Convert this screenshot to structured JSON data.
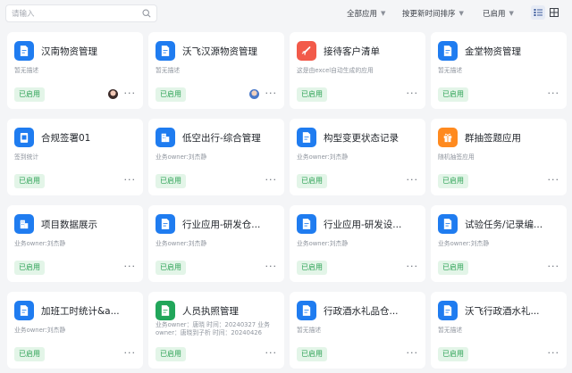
{
  "search": {
    "placeholder": "请输入"
  },
  "filters": {
    "status_filter": "全部应用",
    "sort": "按更新时间排序",
    "enabled_filter": "已启用"
  },
  "colors": {
    "icon_blue": "#1f7cf0",
    "icon_green": "#21a65a",
    "icon_red": "#f25a4a",
    "icon_orange": "#ff8a1f",
    "status_green": "#2ea256"
  },
  "apps": [
    {
      "name": "汉南物资管理",
      "desc": "暂无描述",
      "status": "已启用",
      "icon": "document-icon"
    },
    {
      "name": "沃飞汉源物资管理",
      "desc": "暂无描述",
      "status": "已启用",
      "icon": "document-icon"
    },
    {
      "name": "接待客户清单",
      "desc": "这是由excel自动生成的应用",
      "status": "已启用",
      "icon": "plane-icon"
    },
    {
      "name": "金堂物资管理",
      "desc": "暂无描述",
      "status": "已启用",
      "icon": "document-icon"
    },
    {
      "name": "合规签署01",
      "desc": "签到统计",
      "status": "已启用",
      "icon": "clipboard-icon"
    },
    {
      "name": "低空出行-综合管理",
      "desc": "业务owner:刘杰静",
      "status": "已启用",
      "icon": "building-icon"
    },
    {
      "name": "构型变更状态记录",
      "desc": "业务owner:刘杰静",
      "status": "已启用",
      "icon": "document-icon"
    },
    {
      "name": "群抽签题应用",
      "desc": "随机抽签应用",
      "status": "已启用",
      "icon": "gift-icon"
    },
    {
      "name": "项目数据展示",
      "desc": "业务owner:刘杰静",
      "status": "已启用",
      "icon": "building-icon"
    },
    {
      "name": "行业应用-研发仓...",
      "desc": "业务owner:刘杰静",
      "status": "已启用",
      "icon": "document-icon"
    },
    {
      "name": "行业应用-研发设...",
      "desc": "业务owner:刘杰静",
      "status": "已启用",
      "icon": "document-icon"
    },
    {
      "name": "试验任务/记录编...",
      "desc": "业务owner:刘杰静",
      "status": "已启用",
      "icon": "document-icon"
    },
    {
      "name": "加班工时统计&a...",
      "desc": "业务owner:刘杰静",
      "status": "已启用",
      "icon": "document-icon"
    },
    {
      "name": "人员执照管理",
      "desc": "业务owner：唐晓 时间：20240327 业务owner：唐晓到子析 时间：20240426",
      "status": "已启用",
      "icon": "document-icon"
    },
    {
      "name": "行政酒水礼品仓...",
      "desc": "暂无描述",
      "status": "已启用",
      "icon": "document-icon"
    },
    {
      "name": "沃飞行政酒水礼...",
      "desc": "暂无描述",
      "status": "已启用",
      "icon": "document-icon"
    }
  ],
  "more_label": "···"
}
